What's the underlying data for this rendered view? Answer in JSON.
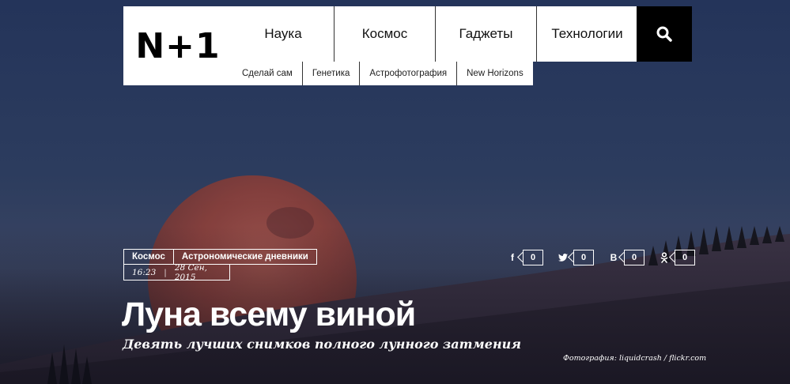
{
  "logo": {
    "text": "N+1"
  },
  "nav": {
    "main": [
      "Наука",
      "Космос",
      "Гаджеты",
      "Технологии"
    ],
    "sub": [
      "Сделай сам",
      "Генетика",
      "Астрофотография",
      "New Horizons"
    ],
    "search_icon": "search-icon"
  },
  "article": {
    "tags": [
      "Космос",
      "Астрономические дневники"
    ],
    "time": "16:23",
    "date": "28 Сен, 2015",
    "title": "Луна всему виной",
    "subtitle": "Девять лучших снимков полного лунного затмения",
    "photo_credit": "Фотография: liquidcrash / flickr.com"
  },
  "share": [
    {
      "icon": "facebook-icon",
      "glyph": "f",
      "count": "0"
    },
    {
      "icon": "twitter-icon",
      "glyph": "",
      "count": "0"
    },
    {
      "icon": "vk-icon",
      "glyph": "B",
      "count": "0"
    },
    {
      "icon": "odnoklassniki-icon",
      "glyph": "",
      "count": "0"
    }
  ],
  "colors": {
    "sky": "#2b3a5a",
    "moon": "#8a3f3a",
    "header_bg": "#ffffff",
    "search_bg": "#000000"
  }
}
